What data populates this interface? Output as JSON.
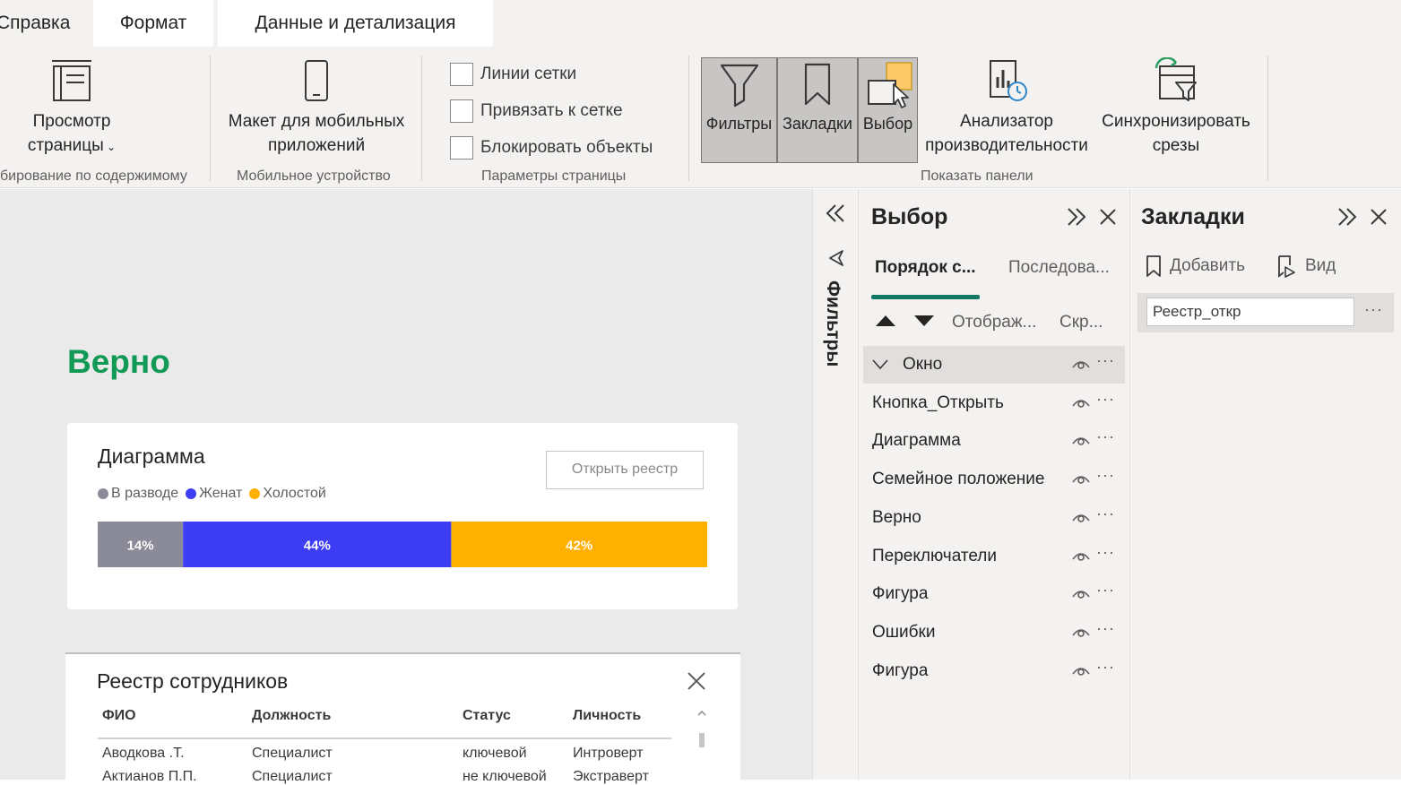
{
  "ribbon": {
    "tabs": [
      {
        "label": "Справка"
      },
      {
        "label": "Формат"
      },
      {
        "label": "Данные и детализация"
      }
    ],
    "page_view": {
      "label_line1": "Просмотр",
      "label_line2": "страницы",
      "group_label": "бирование по содержимому"
    },
    "mobile": {
      "label_line1": "Макет для мобильных",
      "label_line2": "приложений",
      "group_label": "Мобильное устройство"
    },
    "page_options": {
      "checkboxes": [
        {
          "label": "Линии сетки",
          "checked": false
        },
        {
          "label": "Привязать к сетке",
          "checked": false
        },
        {
          "label": "Блокировать объекты",
          "checked": false
        }
      ],
      "group_label": "Параметры страницы"
    },
    "show_panes": {
      "filters_label": "Фильтры",
      "bookmarks_label": "Закладки",
      "selection_label": "Выбор",
      "performance_line1": "Анализатор",
      "performance_line2": "производительности",
      "sync_line1": "Синхронизировать",
      "sync_line2": "срезы",
      "group_label": "Показать панели"
    }
  },
  "canvas": {
    "verno_title": "Верно",
    "chart_card": {
      "title": "Диаграмма",
      "open_button": "Открыть реестр"
    },
    "registry": {
      "title": "Реестр сотрудников",
      "columns": [
        "ФИО",
        "Должность",
        "Статус",
        "Личность"
      ],
      "rows": [
        [
          "Аводкова .Т.",
          "Специалист",
          "ключевой",
          "Интроверт"
        ],
        [
          "Актианов П.П.",
          "Специалист",
          "не ключевой",
          "Экстраверт"
        ]
      ]
    }
  },
  "chart_data": {
    "type": "bar",
    "orientation": "horizontal-stacked-100",
    "title": "Диаграмма",
    "categories": [
      ""
    ],
    "series": [
      {
        "name": "В разводе",
        "values": [
          14
        ],
        "label": "14%",
        "color": "#8a8a99"
      },
      {
        "name": "Женат",
        "values": [
          44
        ],
        "label": "44%",
        "color": "#3d3df5"
      },
      {
        "name": "Холостой",
        "values": [
          42
        ],
        "label": "42%",
        "color": "#ffb000"
      }
    ],
    "legend_position": "top-left",
    "xlim": [
      0,
      100
    ]
  },
  "filters_strip": {
    "label": "Фильтры"
  },
  "selection_pane": {
    "title": "Выбор",
    "tabs": [
      "Порядок с...",
      "Последова..."
    ],
    "columns": {
      "show": "Отображ...",
      "hide": "Скр..."
    },
    "layers": [
      {
        "label": "Окно",
        "group": true,
        "selected": true
      },
      {
        "label": "Кнопка_Открыть"
      },
      {
        "label": "Диаграмма"
      },
      {
        "label": "Семейное положение"
      },
      {
        "label": "Верно"
      },
      {
        "label": "Переключатели"
      },
      {
        "label": "Фигура"
      },
      {
        "label": "Ошибки"
      },
      {
        "label": "Фигура"
      }
    ],
    "more": "···"
  },
  "bookmarks_pane": {
    "title": "Закладки",
    "add_label": "Добавить",
    "view_label": "Вид",
    "bookmark_input_value": "Реестр_откр",
    "more": "···"
  },
  "colors": {
    "accent": "#117865",
    "verno_green": "#119a55",
    "selection_highlight": "#fdc867"
  }
}
